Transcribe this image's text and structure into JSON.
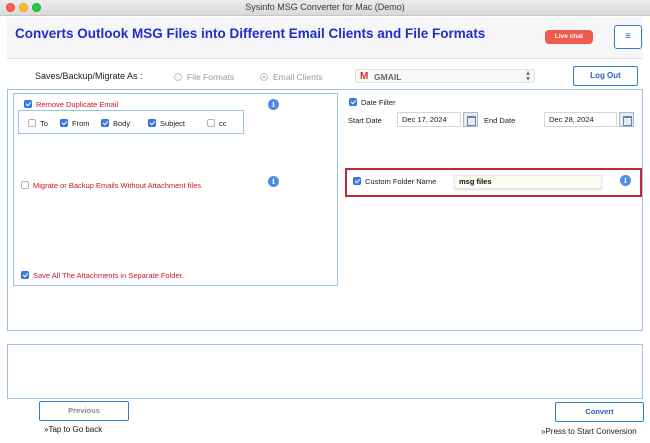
{
  "window": {
    "title": "Sysinfo MSG Converter for Mac (Demo)"
  },
  "header": {
    "headline": "Converts Outlook MSG Files into Different Email Clients and File Formats",
    "live_chat": "Live chat",
    "menu_icon": "hamburger-icon"
  },
  "save_options": {
    "label": "Saves/Backup/Migrate As :",
    "file_formats": "File Formats",
    "email_clients": "Email Clients",
    "selected": "Email Clients",
    "client_select": "GMAIL",
    "logout": "Log Out"
  },
  "left": {
    "remove_duplicate": {
      "label": "Remove Duplicate Email",
      "checked": true
    },
    "dup_fields": [
      {
        "label": "To",
        "checked": false
      },
      {
        "label": "From",
        "checked": true
      },
      {
        "label": "Body",
        "checked": true
      },
      {
        "label": "Subject",
        "checked": true
      },
      {
        "label": "cc",
        "checked": false
      }
    ],
    "migrate_without_attachment": {
      "label": "Migrate or Backup Emails Without Attachment files",
      "checked": false
    },
    "save_attachments": {
      "label": "Save All The Attachments in Separate Folder.",
      "checked": true
    }
  },
  "right": {
    "date_filter": {
      "label": "Date Filter",
      "checked": true
    },
    "start_date_label": "Start Date",
    "start_date": "Dec 17, 2024",
    "end_date_label": "End Date",
    "end_date": "Dec 28, 2024",
    "custom_folder": {
      "label": "Custom Folder Name",
      "checked": true,
      "value": "msg files"
    }
  },
  "footer": {
    "previous": "Previous",
    "previous_hint": "»Tap to Go back",
    "convert": "Convert",
    "convert_hint": "»Press to Start Conversion"
  },
  "colors": {
    "accent_blue": "#2d7dd2",
    "headline_blue": "#1e2fc8",
    "error_red": "#c9171e",
    "live_chat_red": "#f05a4f",
    "highlight_border": "#c12a35"
  }
}
